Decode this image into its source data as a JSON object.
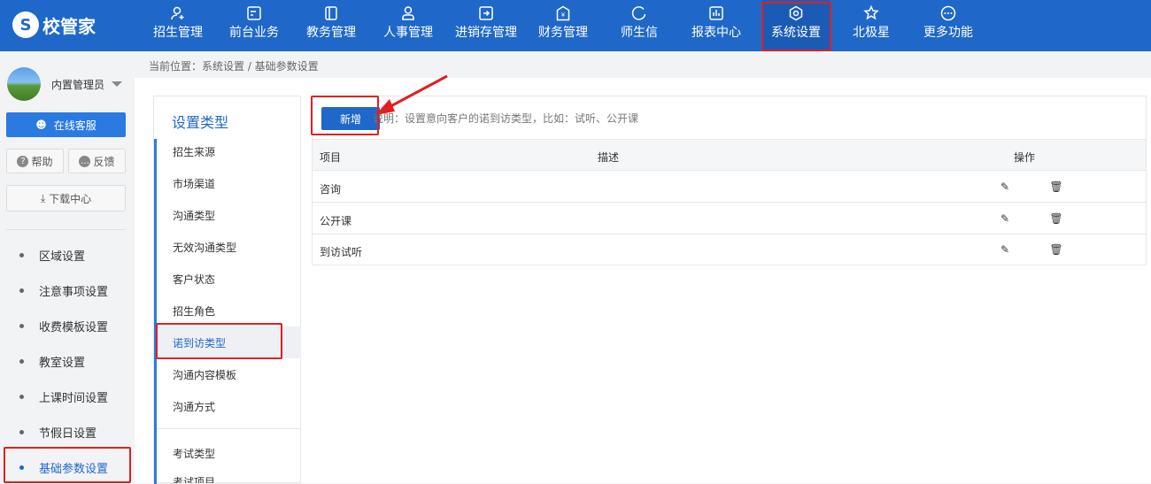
{
  "app": {
    "logo_text": "校管家",
    "logo_mark": "S"
  },
  "topnav": [
    {
      "label": "招生管理",
      "icon": "user-add-icon"
    },
    {
      "label": "前台业务",
      "icon": "monitor-icon"
    },
    {
      "label": "教务管理",
      "icon": "book-icon"
    },
    {
      "label": "人事管理",
      "icon": "person-icon"
    },
    {
      "label": "进销存管理",
      "icon": "inventory-icon"
    },
    {
      "label": "财务管理",
      "icon": "yen-icon"
    },
    {
      "label": "师生信",
      "icon": "chat-icon"
    },
    {
      "label": "报表中心",
      "icon": "chart-icon"
    },
    {
      "label": "系统设置",
      "icon": "gear-icon"
    },
    {
      "label": "北极星",
      "icon": "star-icon"
    },
    {
      "label": "更多功能",
      "icon": "more-icon"
    }
  ],
  "user": {
    "name": "内置管理员"
  },
  "sidebar": {
    "service_label": "在线客服",
    "help_label": "帮助",
    "feedback_label": "反馈",
    "download_label": "下载中心",
    "items": [
      {
        "label": "区域设置"
      },
      {
        "label": "注意事项设置"
      },
      {
        "label": "收费模板设置"
      },
      {
        "label": "教室设置"
      },
      {
        "label": "上课时间设置"
      },
      {
        "label": "节假日设置"
      },
      {
        "label": "基础参数设置"
      }
    ]
  },
  "breadcrumb": "当前位置：系统设置 / 基础参数设置",
  "type_panel": {
    "title": "设置类型",
    "items": [
      {
        "label": "招生来源"
      },
      {
        "label": "市场渠道"
      },
      {
        "label": "沟通类型"
      },
      {
        "label": "无效沟通类型"
      },
      {
        "label": "客户状态"
      },
      {
        "label": "招生角色"
      },
      {
        "label": "诺到访类型"
      },
      {
        "label": "沟通内容模板"
      },
      {
        "label": "沟通方式"
      },
      {
        "label": "考试类型"
      },
      {
        "label": "考试项目"
      }
    ]
  },
  "content": {
    "add_label": "新增",
    "note": "说明：设置意向客户的诺到访类型，比如：试听、公开课",
    "columns": [
      "项目",
      "描述",
      "操作"
    ],
    "rows": [
      {
        "item": "咨询",
        "desc": ""
      },
      {
        "item": "公开课",
        "desc": ""
      },
      {
        "item": "到访试听",
        "desc": ""
      }
    ]
  },
  "colors": {
    "primary": "#1f68c9",
    "highlight": "#e02020"
  }
}
